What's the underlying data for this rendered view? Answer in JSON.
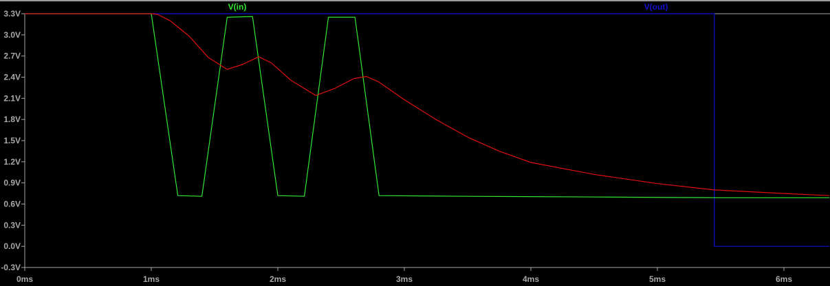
{
  "chart_data": {
    "type": "line",
    "title": "",
    "xlabel": "",
    "ylabel": "",
    "xlim": [
      0,
      6.36
    ],
    "ylim": [
      -0.3,
      3.3
    ],
    "grid": false,
    "x_unit": "ms",
    "y_unit": "V",
    "x_ticks": [
      "0ms",
      "1ms",
      "2ms",
      "3ms",
      "4ms",
      "5ms",
      "6ms"
    ],
    "y_ticks": [
      "3.3V",
      "3.0V",
      "2.7V",
      "2.4V",
      "2.1V",
      "1.8V",
      "1.5V",
      "1.2V",
      "0.9V",
      "0.6V",
      "0.3V",
      "0.0V",
      "-0.3V"
    ],
    "legend_placement": "top",
    "series": [
      {
        "name": "V(in)",
        "color": "#33e633",
        "show_label": true,
        "x": [
          0,
          1.0,
          1.21,
          1.4,
          1.6,
          1.8,
          2.0,
          2.21,
          2.4,
          2.61,
          2.8,
          3.5,
          4.5,
          5.5,
          6.36
        ],
        "y": [
          3.3,
          3.3,
          0.72,
          0.71,
          3.25,
          3.26,
          0.72,
          0.71,
          3.25,
          3.25,
          0.72,
          0.71,
          0.7,
          0.69,
          0.69
        ]
      },
      {
        "name": "V(out)",
        "color": "#1010d0",
        "show_label": true,
        "x": [
          0,
          5.45,
          5.45,
          6.36
        ],
        "y": [
          3.3,
          3.3,
          0.0,
          0.0
        ]
      },
      {
        "name": "",
        "color": "#e01010",
        "show_label": false,
        "x": [
          0,
          1.0,
          1.05,
          1.15,
          1.3,
          1.45,
          1.6,
          1.72,
          1.85,
          1.95,
          2.1,
          2.3,
          2.45,
          2.6,
          2.7,
          2.8,
          3.0,
          3.25,
          3.5,
          3.75,
          4.0,
          4.5,
          5.0,
          5.45,
          6.0,
          6.36
        ],
        "y": [
          3.3,
          3.3,
          3.29,
          3.2,
          2.98,
          2.68,
          2.51,
          2.58,
          2.69,
          2.6,
          2.36,
          2.14,
          2.24,
          2.38,
          2.41,
          2.33,
          2.08,
          1.8,
          1.55,
          1.35,
          1.19,
          1.02,
          0.89,
          0.8,
          0.75,
          0.72
        ]
      }
    ]
  }
}
